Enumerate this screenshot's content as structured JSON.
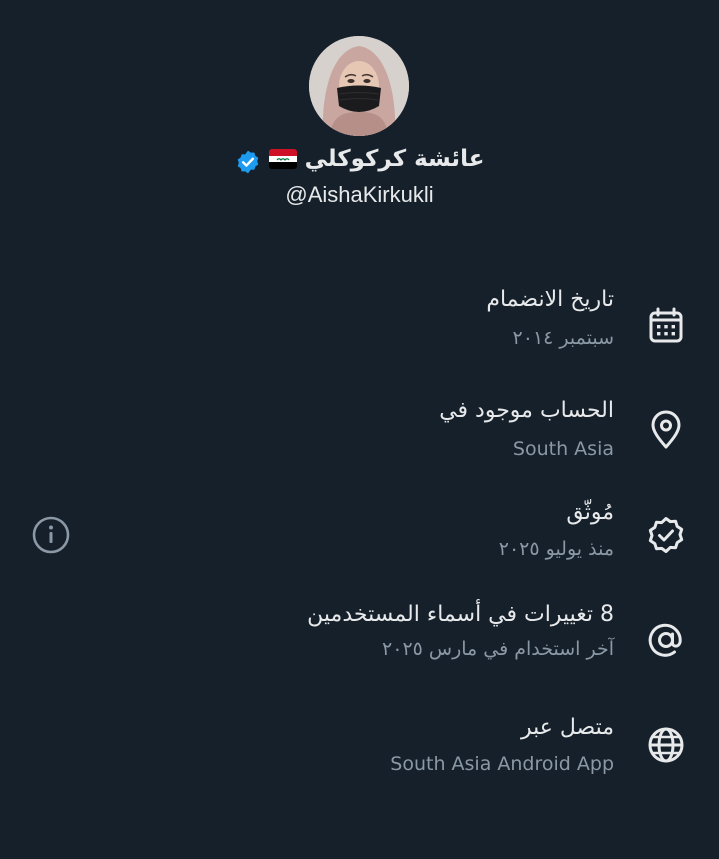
{
  "profile": {
    "display_name": "عائشة كركوكلي",
    "flag_icon": "iraq-flag-icon",
    "verified_icon": "verified-badge-icon",
    "handle": "@AishaKirkukli"
  },
  "rows": [
    {
      "icon": "calendar-icon",
      "label": "تاريخ الانضمام",
      "value": "سبتمبر ٢٠١٤"
    },
    {
      "icon": "location-pin-icon",
      "label": "الحساب موجود في",
      "value": "South Asia"
    },
    {
      "icon": "verified-check-icon",
      "label": "مُوثّق",
      "value": "منذ يوليو ٢٠٢٥"
    },
    {
      "icon": "at-sign-icon",
      "label": "8 تغييرات في أسماء المستخدمين",
      "value": "آخر استخدام في مارس ٢٠٢٥"
    },
    {
      "icon": "globe-icon",
      "label": "متصل عبر",
      "value": "South Asia Android App"
    }
  ],
  "colors": {
    "background": "#15202b",
    "primary_text": "#e7e9ea",
    "secondary_text": "#8b98a5",
    "verified_blue": "#1d9bf0"
  }
}
